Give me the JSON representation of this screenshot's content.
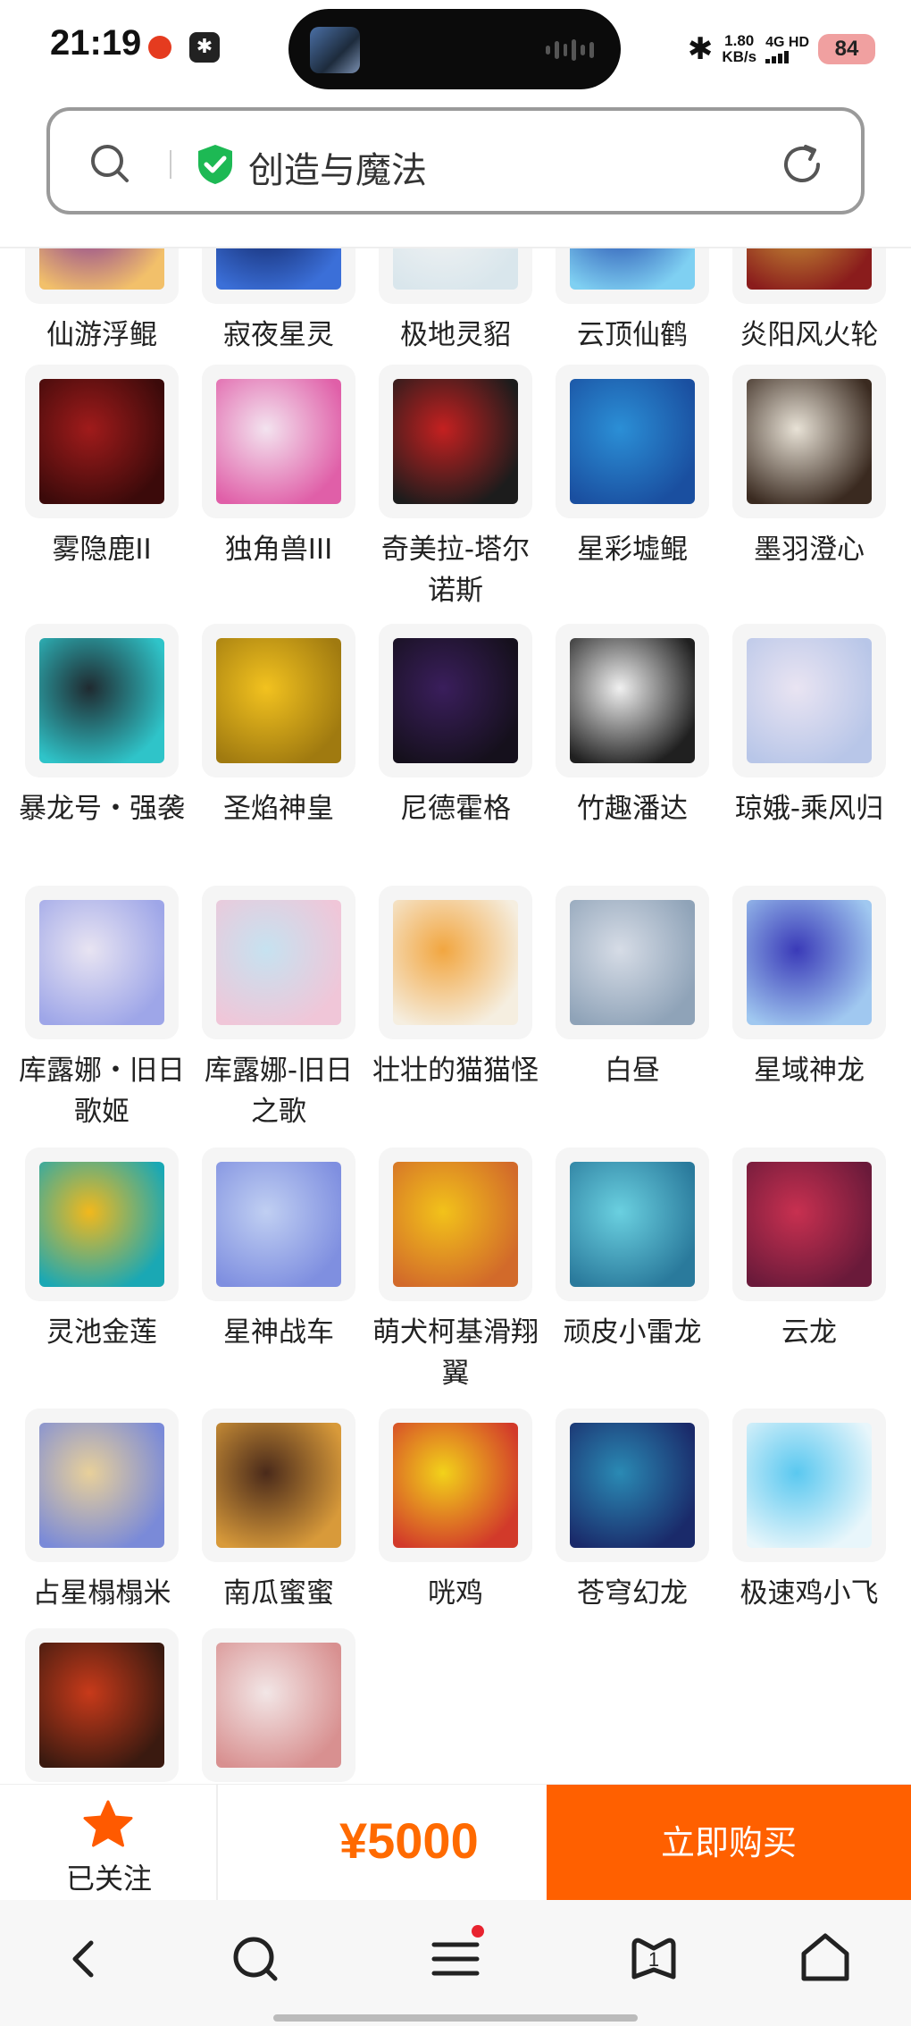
{
  "status_bar": {
    "time": "21:19",
    "net_speed_value": "1.80",
    "net_speed_unit": "KB/s",
    "network_type": "4G HD",
    "battery": "84",
    "icons": [
      "red-app-icon",
      "bluetooth-app-icon",
      "bluetooth-icon",
      "signal-icon"
    ]
  },
  "search": {
    "query": "创造与魔法",
    "icons": [
      "search-icon",
      "verified-shield-icon",
      "refresh-icon"
    ]
  },
  "grid": {
    "rows": [
      {
        "items": [
          {
            "label": "仙游浮鲲",
            "c1": "#7a2a9c",
            "c2": "#f2c06a"
          },
          {
            "label": "寂夜星灵",
            "c1": "#0d1f5c",
            "c2": "#3b6fd8"
          },
          {
            "label": "极地灵貂",
            "c1": "#f4f4f4",
            "c2": "#d9e6ec"
          },
          {
            "label": "云顶仙鹤",
            "c1": "#1c3fa8",
            "c2": "#7fd0f2"
          },
          {
            "label": "炎阳风火轮",
            "c1": "#d0a43a",
            "c2": "#8a1c1c"
          }
        ]
      },
      {
        "items": [
          {
            "label": "雾隐鹿II",
            "c1": "#a01b1b",
            "c2": "#3b0a0a"
          },
          {
            "label": "独角兽III",
            "c1": "#f3e3ef",
            "c2": "#e05fa8"
          },
          {
            "label": "奇美拉-塔尔诺斯",
            "c1": "#c42020",
            "c2": "#1c1c1c"
          },
          {
            "label": "星彩墟鲲",
            "c1": "#2b8fd6",
            "c2": "#1a4fa0"
          },
          {
            "label": "墨羽澄心",
            "c1": "#e8e2d6",
            "c2": "#3a2a20"
          }
        ]
      },
      {
        "items": [
          {
            "label": "暴龙号・强袭",
            "c1": "#1f2a30",
            "c2": "#2fc4c9"
          },
          {
            "label": "圣焰神皇",
            "c1": "#f2c21f",
            "c2": "#a07a10"
          },
          {
            "label": "尼德霍格",
            "c1": "#3a1e5c",
            "c2": "#15101c"
          },
          {
            "label": "竹趣潘达",
            "c1": "#f0f0f0",
            "c2": "#202020"
          },
          {
            "label": "琼娥-乘风归",
            "c1": "#e9e4f2",
            "c2": "#b8c6e8"
          }
        ]
      },
      {
        "items": [
          {
            "label": "库露娜・旧日歌姬",
            "c1": "#e8e4f2",
            "c2": "#9ea6e8"
          },
          {
            "label": "库露娜-旧日之歌",
            "c1": "#c6e2f0",
            "c2": "#f0c6d8"
          },
          {
            "label": "壮壮的猫猫怪",
            "c1": "#f2a640",
            "c2": "#f5eee0"
          },
          {
            "label": "白昼",
            "c1": "#d6dce6",
            "c2": "#8fa3b8"
          },
          {
            "label": "星域神龙",
            "c1": "#3a3ab8",
            "c2": "#a0c8f0"
          }
        ]
      },
      {
        "items": [
          {
            "label": "灵池金莲",
            "c1": "#f2b81c",
            "c2": "#1aa8b4"
          },
          {
            "label": "星神战车",
            "c1": "#c0cff2",
            "c2": "#7f8fe0"
          },
          {
            "label": "萌犬柯基滑翔翼",
            "c1": "#f2c21a",
            "c2": "#d26a2a"
          },
          {
            "label": "顽皮小雷龙",
            "c1": "#6ad0e0",
            "c2": "#2a7a9c"
          },
          {
            "label": "云龙",
            "c1": "#c83050",
            "c2": "#6a1a3a"
          }
        ]
      },
      {
        "items": [
          {
            "label": "占星榻榻米",
            "c1": "#e8d09a",
            "c2": "#7a8ad8"
          },
          {
            "label": "南瓜蜜蜜",
            "c1": "#4a2a1a",
            "c2": "#d89a3a"
          },
          {
            "label": "咣鸡",
            "c1": "#f2d21a",
            "c2": "#d23a2a"
          },
          {
            "label": "苍穹幻龙",
            "c1": "#2a8ab4",
            "c2": "#1a2a6a"
          },
          {
            "label": "极速鸡小飞",
            "c1": "#5ac8f0",
            "c2": "#e8f6fb"
          }
        ]
      },
      {
        "items": [
          {
            "label": "",
            "c1": "#c83a1a",
            "c2": "#3a1a10"
          },
          {
            "label": "",
            "c1": "#f2e6e6",
            "c2": "#d89090"
          }
        ]
      }
    ]
  },
  "purchase": {
    "follow_label": "已关注",
    "price": "¥5000",
    "buy_label": "立即购买",
    "icons": [
      "star-icon"
    ]
  },
  "bottom_nav": {
    "tabs_badge": "1",
    "icons": [
      "back-icon",
      "search-icon",
      "menu-icon",
      "tabs-icon",
      "home-icon"
    ]
  },
  "colors": {
    "accent": "#ff6000",
    "price": "#ff6a00",
    "verified": "#1db954",
    "notification_dot": "#e8232f"
  }
}
